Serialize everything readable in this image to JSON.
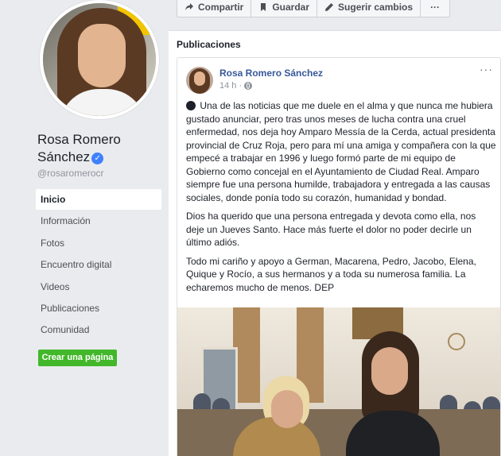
{
  "profile": {
    "name": "Rosa Romero Sánchez",
    "handle": "@rosaromerocr"
  },
  "nav": [
    {
      "label": "Inicio",
      "active": true
    },
    {
      "label": "Información"
    },
    {
      "label": "Fotos"
    },
    {
      "label": "Encuentro digital"
    },
    {
      "label": "Videos"
    },
    {
      "label": "Publicaciones"
    },
    {
      "label": "Comunidad"
    }
  ],
  "create_page_label": "Crear una página",
  "actions": {
    "share": "Compartir",
    "save": "Guardar",
    "suggest": "Sugerir cambios",
    "more": "···"
  },
  "section_title": "Publicaciones",
  "post": {
    "author": "Rosa Romero Sánchez",
    "time": "14 h ·",
    "more": "···",
    "paragraphs": [
      "Una de las noticias que me duele en el alma y que nunca me hubiera gustado anunciar, pero tras unos meses de lucha contra una cruel enfermedad, nos deja hoy Amparo Messía de la Cerda, actual presidenta provincial de Cruz Roja, pero para mí una amiga y compañera con la que empecé a trabajar en 1996 y luego formó parte de mi equipo de Gobierno como concejal en el Ayuntamiento de Ciudad Real. Amparo siempre fue una persona humilde, trabajadora y entregada a las causas sociales, donde ponía todo su corazón, humanidad y bondad.",
      "Dios ha querido que una persona entregada y devota como ella, nos deje un Jueves Santo. Hace más fuerte el dolor no poder decirle un último adiós.",
      "Todo mi cariño y apoyo a German, Macarena, Pedro, Jacobo, Elena, Quique y Rocío, a sus hermanos y a toda su numerosa familia. La echaremos mucho de menos. DEP"
    ]
  },
  "colors": {
    "brand_blue": "#365899",
    "verified": "#4080ff",
    "create_button": "#42b72a"
  }
}
